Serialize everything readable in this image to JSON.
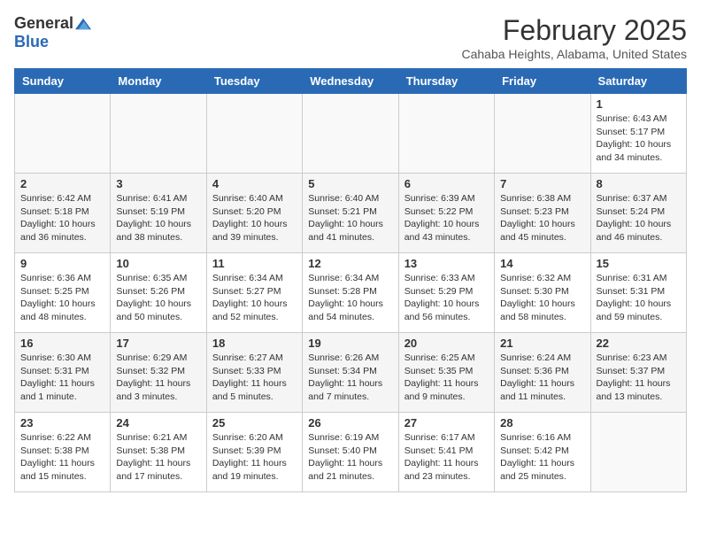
{
  "header": {
    "logo_general": "General",
    "logo_blue": "Blue",
    "month_title": "February 2025",
    "location": "Cahaba Heights, Alabama, United States"
  },
  "weekdays": [
    "Sunday",
    "Monday",
    "Tuesday",
    "Wednesday",
    "Thursday",
    "Friday",
    "Saturday"
  ],
  "weeks": [
    [
      {
        "day": "",
        "info": ""
      },
      {
        "day": "",
        "info": ""
      },
      {
        "day": "",
        "info": ""
      },
      {
        "day": "",
        "info": ""
      },
      {
        "day": "",
        "info": ""
      },
      {
        "day": "",
        "info": ""
      },
      {
        "day": "1",
        "info": "Sunrise: 6:43 AM\nSunset: 5:17 PM\nDaylight: 10 hours\nand 34 minutes."
      }
    ],
    [
      {
        "day": "2",
        "info": "Sunrise: 6:42 AM\nSunset: 5:18 PM\nDaylight: 10 hours\nand 36 minutes."
      },
      {
        "day": "3",
        "info": "Sunrise: 6:41 AM\nSunset: 5:19 PM\nDaylight: 10 hours\nand 38 minutes."
      },
      {
        "day": "4",
        "info": "Sunrise: 6:40 AM\nSunset: 5:20 PM\nDaylight: 10 hours\nand 39 minutes."
      },
      {
        "day": "5",
        "info": "Sunrise: 6:40 AM\nSunset: 5:21 PM\nDaylight: 10 hours\nand 41 minutes."
      },
      {
        "day": "6",
        "info": "Sunrise: 6:39 AM\nSunset: 5:22 PM\nDaylight: 10 hours\nand 43 minutes."
      },
      {
        "day": "7",
        "info": "Sunrise: 6:38 AM\nSunset: 5:23 PM\nDaylight: 10 hours\nand 45 minutes."
      },
      {
        "day": "8",
        "info": "Sunrise: 6:37 AM\nSunset: 5:24 PM\nDaylight: 10 hours\nand 46 minutes."
      }
    ],
    [
      {
        "day": "9",
        "info": "Sunrise: 6:36 AM\nSunset: 5:25 PM\nDaylight: 10 hours\nand 48 minutes."
      },
      {
        "day": "10",
        "info": "Sunrise: 6:35 AM\nSunset: 5:26 PM\nDaylight: 10 hours\nand 50 minutes."
      },
      {
        "day": "11",
        "info": "Sunrise: 6:34 AM\nSunset: 5:27 PM\nDaylight: 10 hours\nand 52 minutes."
      },
      {
        "day": "12",
        "info": "Sunrise: 6:34 AM\nSunset: 5:28 PM\nDaylight: 10 hours\nand 54 minutes."
      },
      {
        "day": "13",
        "info": "Sunrise: 6:33 AM\nSunset: 5:29 PM\nDaylight: 10 hours\nand 56 minutes."
      },
      {
        "day": "14",
        "info": "Sunrise: 6:32 AM\nSunset: 5:30 PM\nDaylight: 10 hours\nand 58 minutes."
      },
      {
        "day": "15",
        "info": "Sunrise: 6:31 AM\nSunset: 5:31 PM\nDaylight: 10 hours\nand 59 minutes."
      }
    ],
    [
      {
        "day": "16",
        "info": "Sunrise: 6:30 AM\nSunset: 5:31 PM\nDaylight: 11 hours\nand 1 minute."
      },
      {
        "day": "17",
        "info": "Sunrise: 6:29 AM\nSunset: 5:32 PM\nDaylight: 11 hours\nand 3 minutes."
      },
      {
        "day": "18",
        "info": "Sunrise: 6:27 AM\nSunset: 5:33 PM\nDaylight: 11 hours\nand 5 minutes."
      },
      {
        "day": "19",
        "info": "Sunrise: 6:26 AM\nSunset: 5:34 PM\nDaylight: 11 hours\nand 7 minutes."
      },
      {
        "day": "20",
        "info": "Sunrise: 6:25 AM\nSunset: 5:35 PM\nDaylight: 11 hours\nand 9 minutes."
      },
      {
        "day": "21",
        "info": "Sunrise: 6:24 AM\nSunset: 5:36 PM\nDaylight: 11 hours\nand 11 minutes."
      },
      {
        "day": "22",
        "info": "Sunrise: 6:23 AM\nSunset: 5:37 PM\nDaylight: 11 hours\nand 13 minutes."
      }
    ],
    [
      {
        "day": "23",
        "info": "Sunrise: 6:22 AM\nSunset: 5:38 PM\nDaylight: 11 hours\nand 15 minutes."
      },
      {
        "day": "24",
        "info": "Sunrise: 6:21 AM\nSunset: 5:38 PM\nDaylight: 11 hours\nand 17 minutes."
      },
      {
        "day": "25",
        "info": "Sunrise: 6:20 AM\nSunset: 5:39 PM\nDaylight: 11 hours\nand 19 minutes."
      },
      {
        "day": "26",
        "info": "Sunrise: 6:19 AM\nSunset: 5:40 PM\nDaylight: 11 hours\nand 21 minutes."
      },
      {
        "day": "27",
        "info": "Sunrise: 6:17 AM\nSunset: 5:41 PM\nDaylight: 11 hours\nand 23 minutes."
      },
      {
        "day": "28",
        "info": "Sunrise: 6:16 AM\nSunset: 5:42 PM\nDaylight: 11 hours\nand 25 minutes."
      },
      {
        "day": "",
        "info": ""
      }
    ]
  ]
}
